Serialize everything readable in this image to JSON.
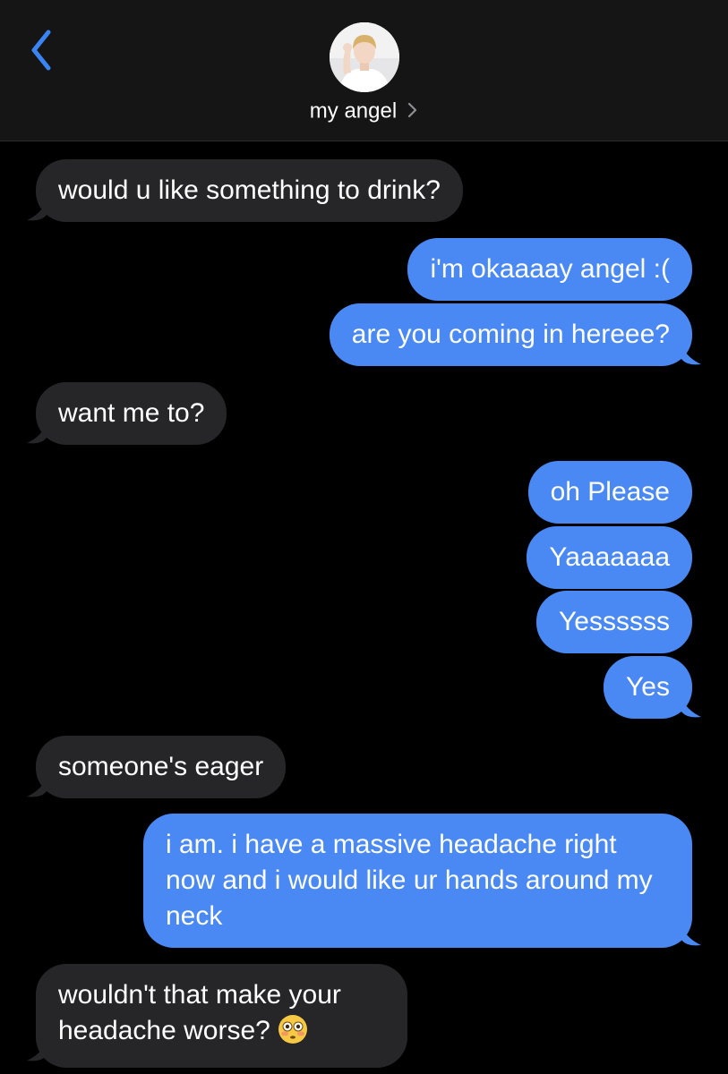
{
  "header": {
    "contact_name": "my angel",
    "back_icon": "chevron-left-icon",
    "detail_icon": "chevron-right-icon"
  },
  "colors": {
    "incoming_bubble": "#262629",
    "outgoing_bubble": "#4a89f3",
    "accent": "#3a84f6"
  },
  "messages": [
    {
      "direction": "incoming",
      "text": "would u like something to drink?"
    },
    {
      "direction": "outgoing",
      "text": "i'm okaaaay angel :("
    },
    {
      "direction": "outgoing",
      "text": "are you coming in hereee?"
    },
    {
      "direction": "incoming",
      "text": "want me to?"
    },
    {
      "direction": "outgoing",
      "text": "oh Please"
    },
    {
      "direction": "outgoing",
      "text": "Yaaaaaaa"
    },
    {
      "direction": "outgoing",
      "text": "Yessssss"
    },
    {
      "direction": "outgoing",
      "text": "Yes"
    },
    {
      "direction": "incoming",
      "text": "someone's eager"
    },
    {
      "direction": "outgoing",
      "text": "i am. i have a massive headache right now and i would like ur hands around my neck"
    },
    {
      "direction": "incoming",
      "text": "wouldn't that make your headache worse?",
      "emoji": "flushed-face-emoji"
    }
  ]
}
